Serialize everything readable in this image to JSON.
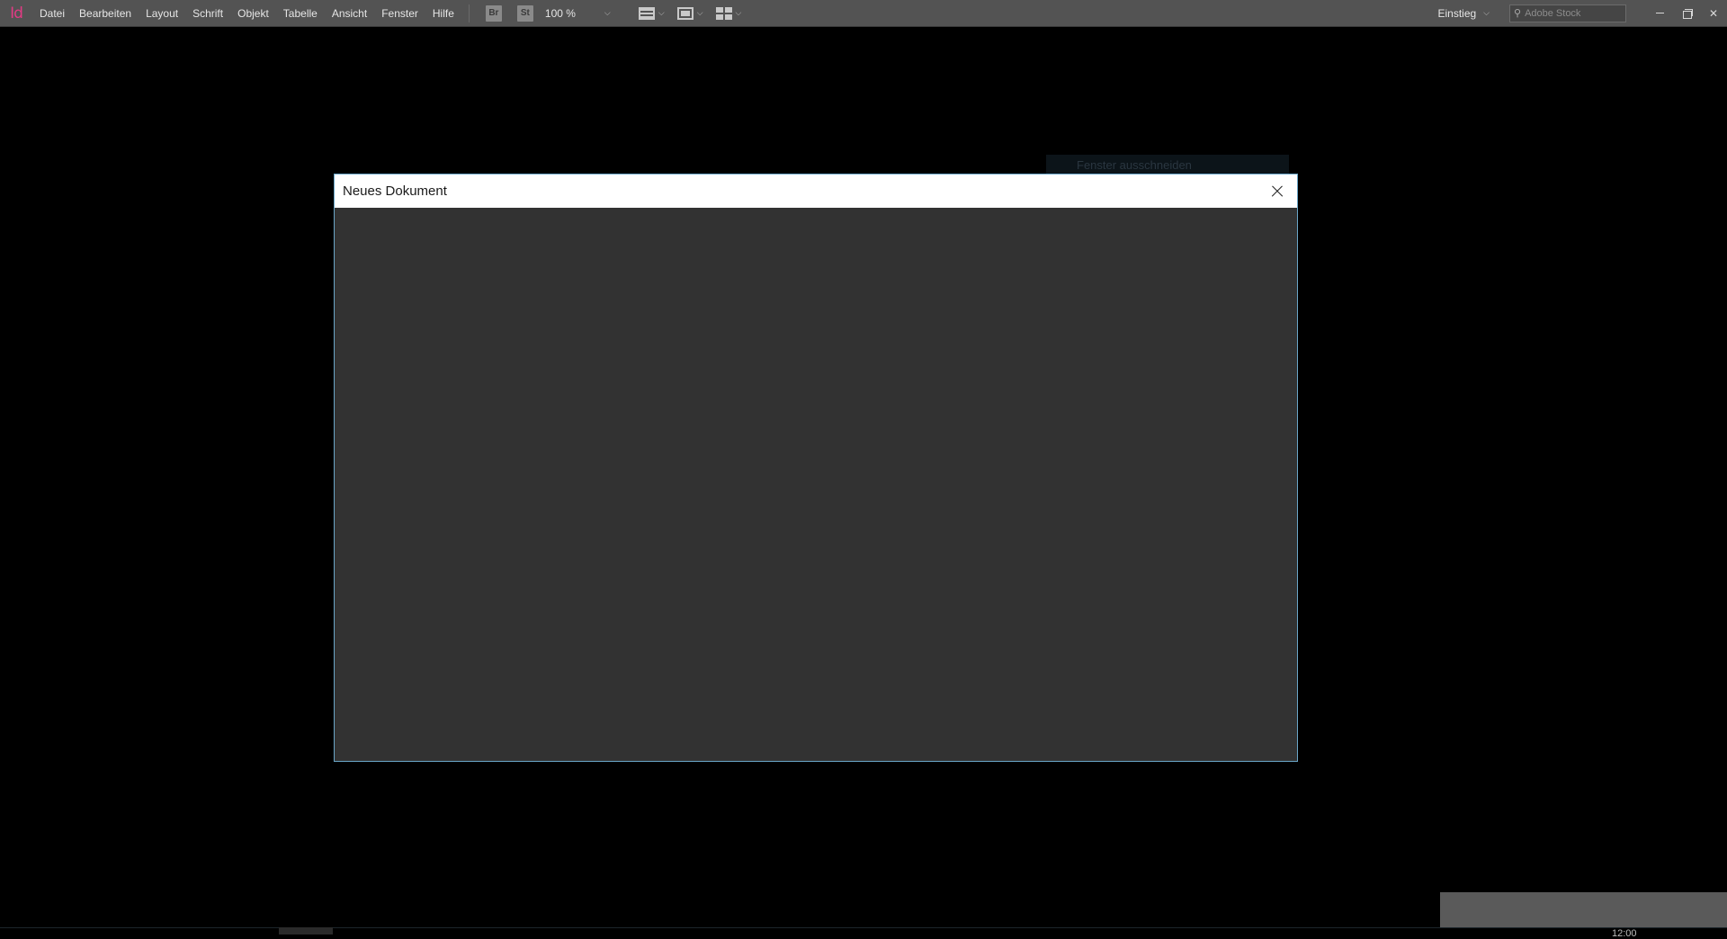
{
  "app": {
    "logo_text": "Id"
  },
  "menu": [
    "Datei",
    "Bearbeiten",
    "Layout",
    "Schrift",
    "Objekt",
    "Tabelle",
    "Ansicht",
    "Fenster",
    "Hilfe"
  ],
  "toolbar": {
    "bridge_label": "Br",
    "stock_label": "St",
    "zoom_value": "100 %"
  },
  "workspace_switcher": {
    "label": "Einstieg"
  },
  "search": {
    "placeholder": "Adobe Stock"
  },
  "ghost_tooltip": {
    "text": "Fenster ausschneiden"
  },
  "dialog": {
    "title": "Neues Dokument"
  },
  "clock": {
    "time": "12:00"
  },
  "colors": {
    "accent_logo": "#e23b84",
    "dialog_border": "#6aa6c8"
  }
}
